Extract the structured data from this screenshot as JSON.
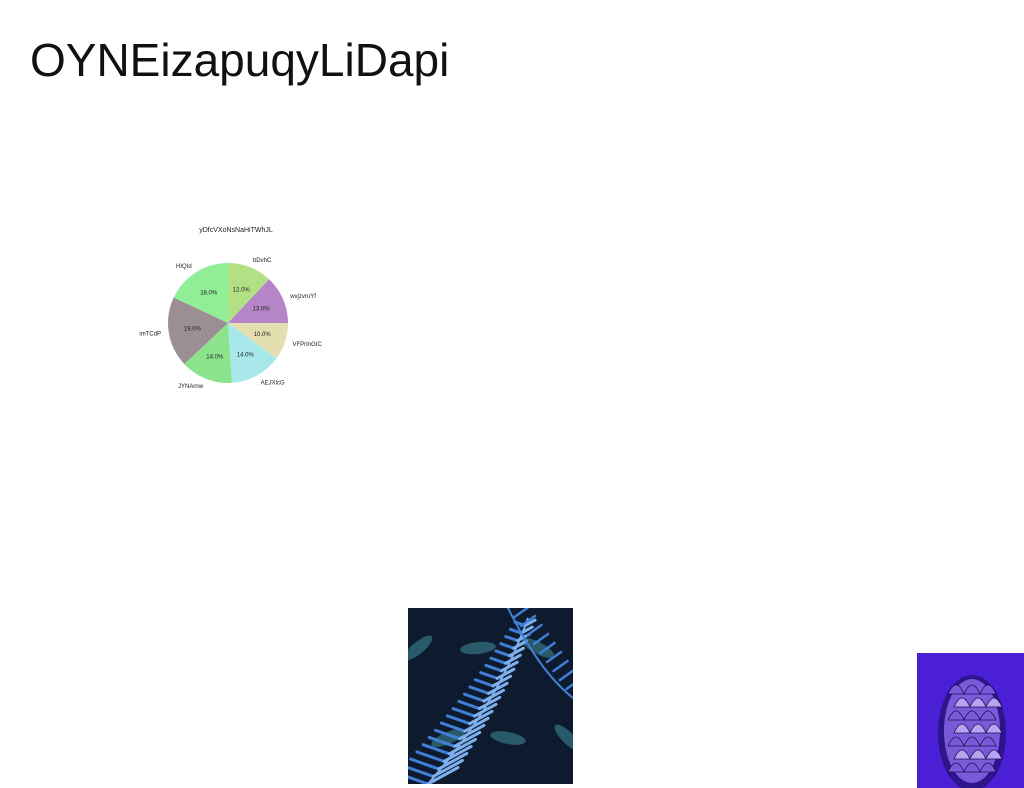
{
  "page": {
    "title": "OYNEizapuqyLiDapi"
  },
  "chart_data": {
    "type": "pie",
    "title": "yDfcVXoNsNaHiTWhJL",
    "start_angle_deg": 90,
    "direction": "clockwise",
    "slices": [
      {
        "label": "bDvhC",
        "value": 12.0,
        "display": "12.0%",
        "color": "#b3e085"
      },
      {
        "label": "wvjzvruYf",
        "value": 13.0,
        "display": "13.0%",
        "color": "#b585c8"
      },
      {
        "label": "VFPrInGIC",
        "value": 10.0,
        "display": "10.0%",
        "color": "#e4dfb1"
      },
      {
        "label": "AEJXlcG",
        "value": 14.0,
        "display": "14.0%",
        "color": "#a8e7ea"
      },
      {
        "label": "JYNArnw",
        "value": 14.0,
        "display": "14.0%",
        "color": "#8ce38b"
      },
      {
        "label": "imTCdP",
        "value": 19.0,
        "display": "19.0%",
        "color": "#9b8f94"
      },
      {
        "label": "HIQId",
        "value": 18.0,
        "display": "18.0%",
        "color": "#90ef96"
      }
    ]
  },
  "images": {
    "fern_colors": {
      "bg": "#0e1a2e",
      "leaf": "#3f7fd6",
      "leaf_light": "#7fb0ee",
      "teal": "#3f8f9a"
    },
    "bud_colors": {
      "bg": "#4a1fd6",
      "petal": "#7a5ad8",
      "petal_light": "#b7a4f0",
      "dark": "#1c0f5a"
    }
  }
}
